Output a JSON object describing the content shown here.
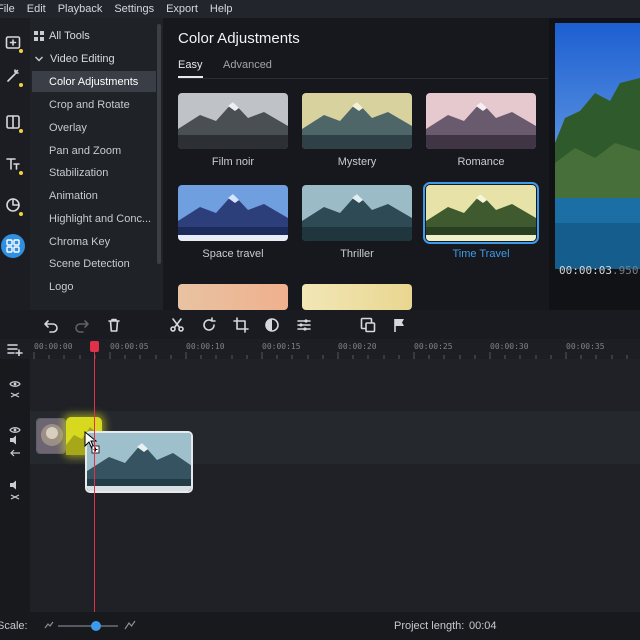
{
  "menu": [
    "File",
    "Edit",
    "Playback",
    "Settings",
    "Export",
    "Help"
  ],
  "tools": {
    "all_tools": "All Tools",
    "section": "Video Editing",
    "items": [
      "Color Adjustments",
      "Crop and Rotate",
      "Overlay",
      "Pan and Zoom",
      "Stabilization",
      "Animation",
      "Highlight and Conc...",
      "Chroma Key",
      "Scene Detection",
      "Logo"
    ],
    "selected": "Color Adjustments"
  },
  "panel": {
    "title": "Color Adjustments",
    "tabs": [
      "Easy",
      "Advanced"
    ],
    "active_tab": "Easy",
    "filters": [
      "Film noir",
      "Mystery",
      "Romance",
      "Space travel",
      "Thriller",
      "Time Travel"
    ],
    "selected_filter": "Time Travel",
    "accent": "#3d9be9"
  },
  "preview": {
    "timecode": "00:00:03",
    "timecode_ms": ".950"
  },
  "ruler": {
    "labels": [
      "00:00:00",
      "00:00:05",
      "00:00:10",
      "00:00:15",
      "00:00:20",
      "00:00:25",
      "00:00:30",
      "00:00:35"
    ]
  },
  "bottom": {
    "scale_label": "Scale:",
    "project_length_label": "Project length:",
    "project_length_value": "00:04"
  },
  "colors": {
    "playhead": "#e0314a",
    "selection": "#3d9be9",
    "rail_dot": "#f0d437"
  },
  "icons": [
    "add-media-icon",
    "magic-wand-icon",
    "transitions-icon",
    "titles-icon",
    "stickers-icon",
    "more-tools-icon",
    "undo-icon",
    "redo-icon",
    "delete-icon",
    "cut-icon",
    "rotate-icon",
    "crop-icon",
    "color-icon",
    "adjust-icon",
    "pip-icon",
    "marker-icon",
    "add-track-icon",
    "eye-icon",
    "link-icon",
    "speaker-icon",
    "arrow-icon"
  ]
}
